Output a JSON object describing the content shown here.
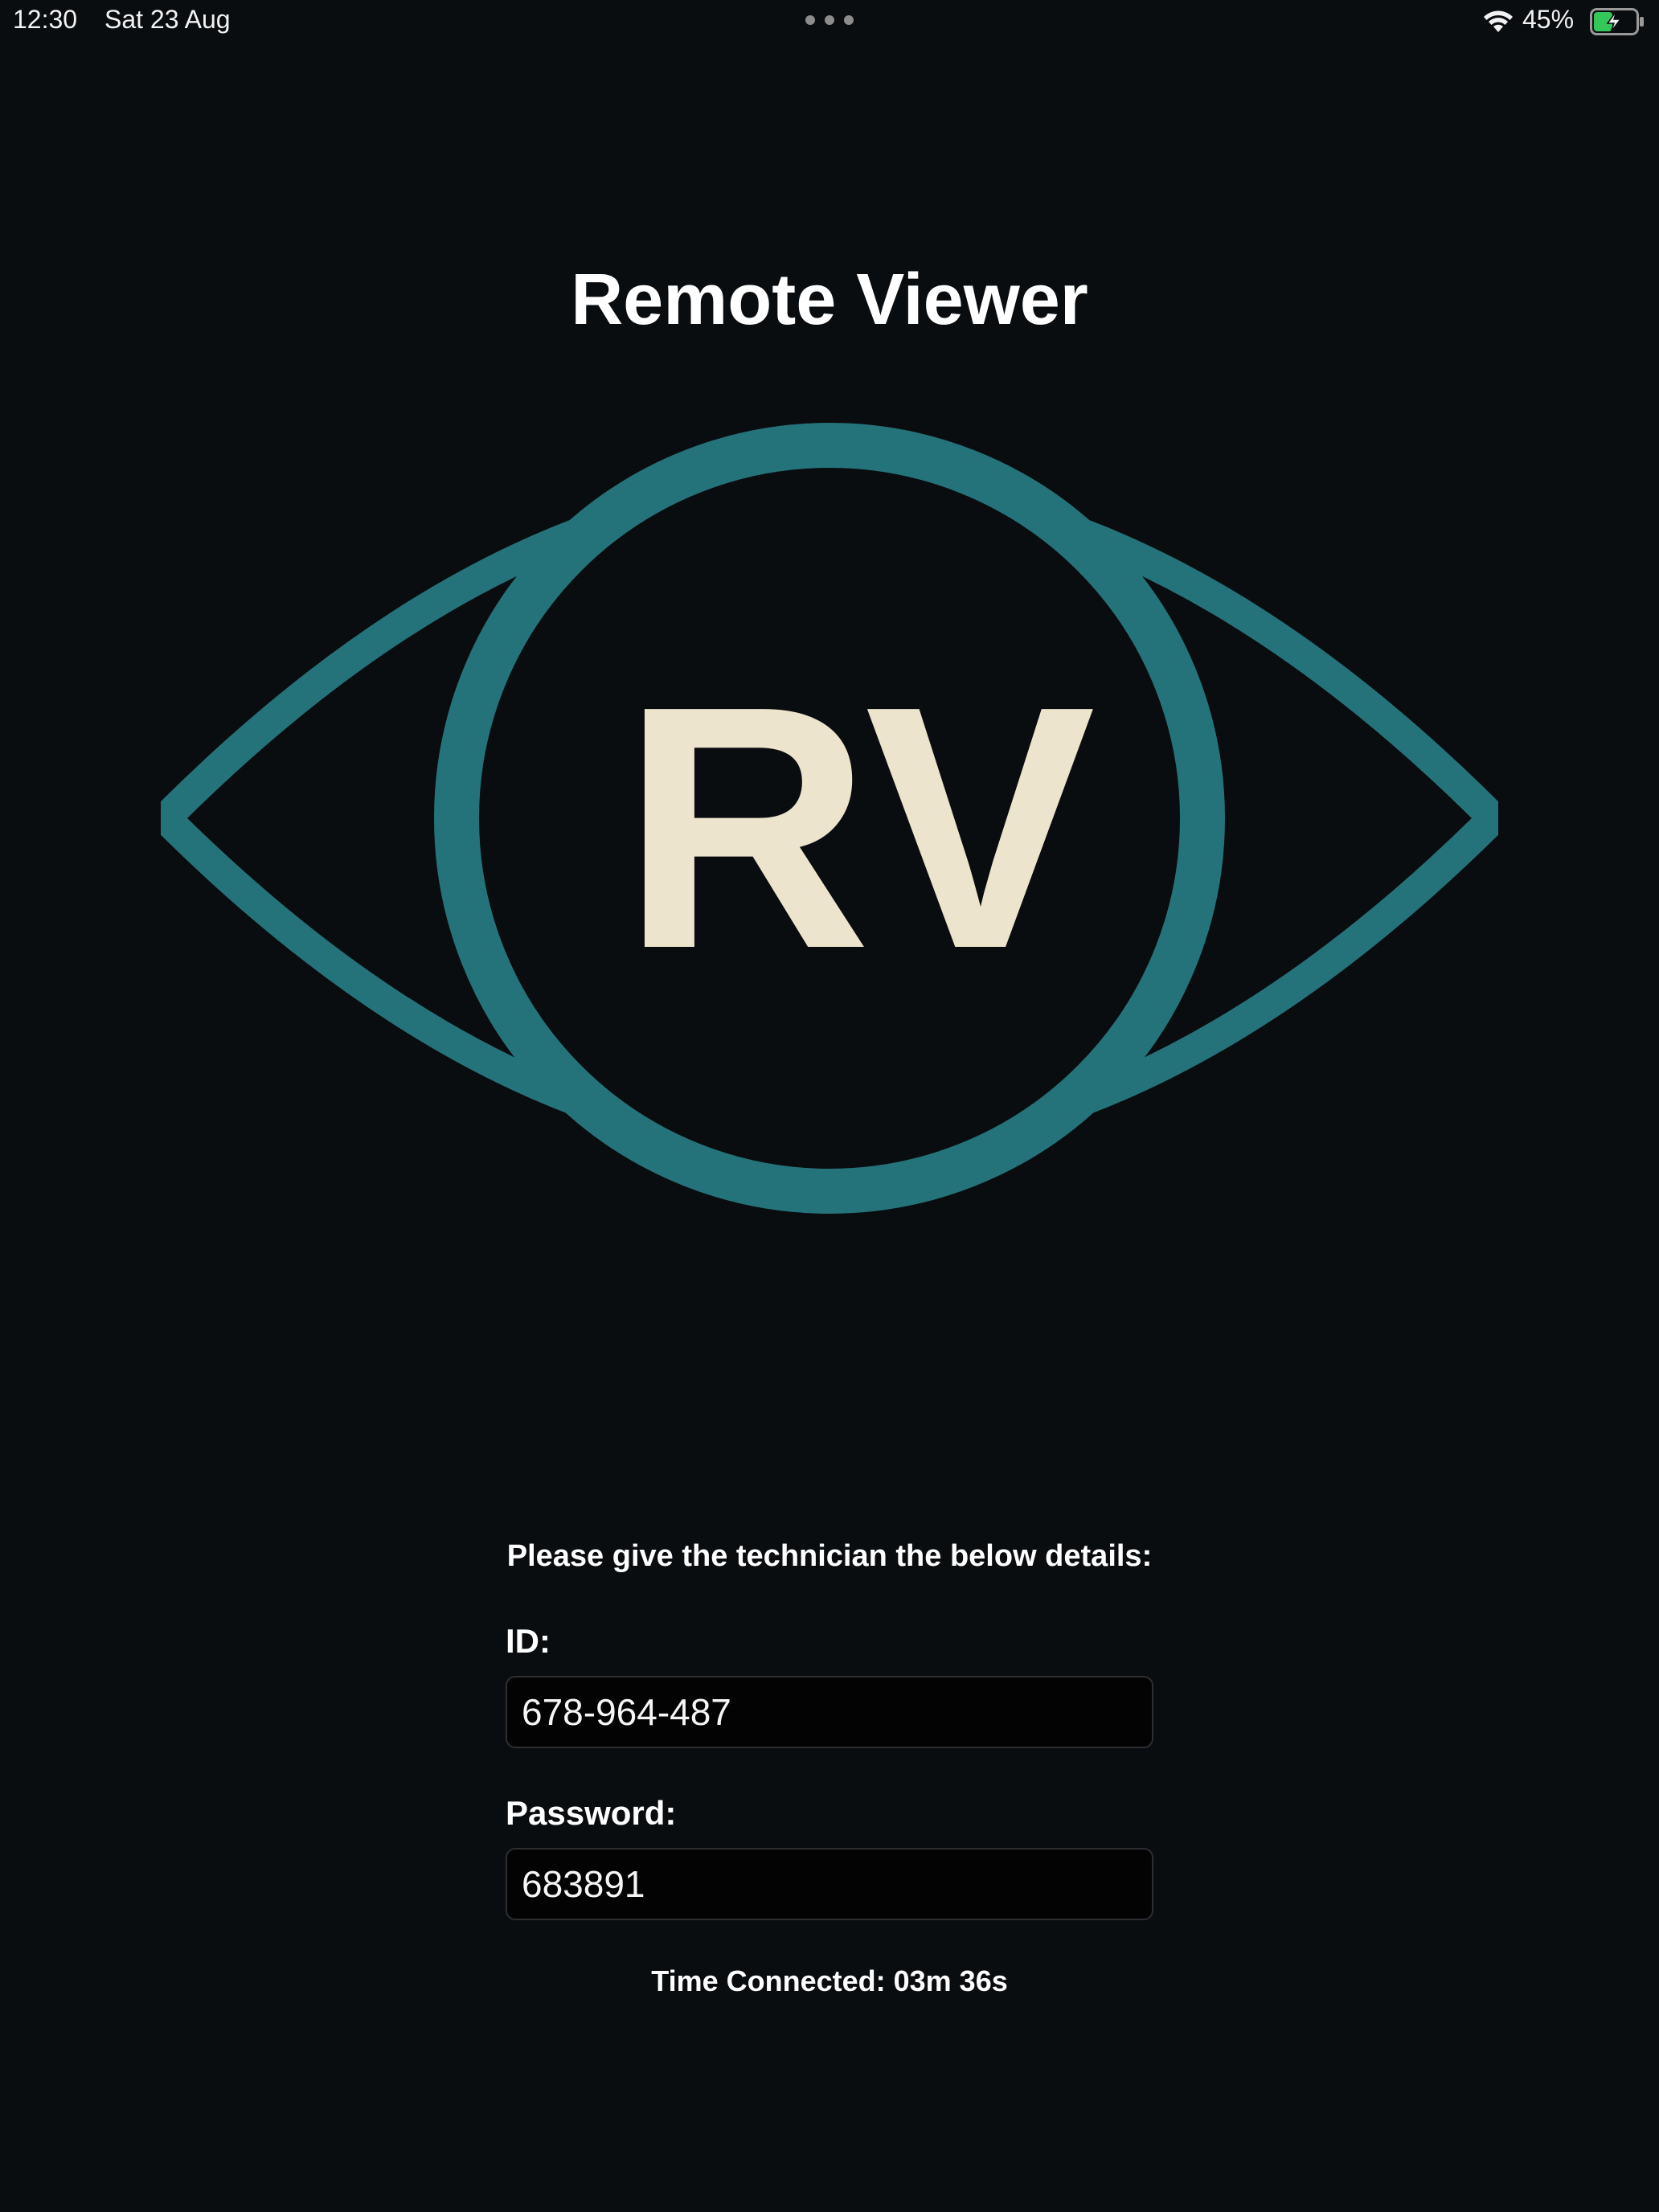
{
  "status_bar": {
    "time": "12:30",
    "date": "Sat 23 Aug",
    "battery_percent": "45%",
    "battery_level": 0.45,
    "charging": true,
    "icons": [
      "multitasking-dots-icon",
      "wifi-icon",
      "battery-charging-icon"
    ]
  },
  "app": {
    "title": "Remote Viewer",
    "logo_text": "RV"
  },
  "details": {
    "instruction": "Please give the technician the below details:",
    "id_label": "ID:",
    "id_value": "678-964-487",
    "password_label": "Password:",
    "password_value": "683891",
    "time_connected": "Time Connected: 03m 36s"
  },
  "colors": {
    "background": "#0a0d10",
    "logo_teal": "#25737a",
    "logo_letters": "#ede4cd",
    "battery_green": "#34c759"
  }
}
